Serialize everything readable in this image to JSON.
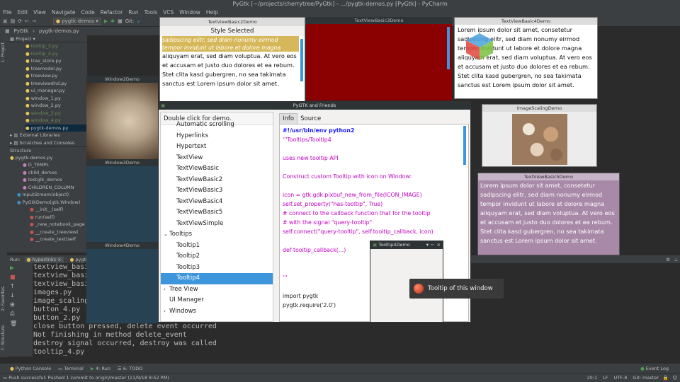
{
  "ide": {
    "title": "PyGtk [~/projects/cherrytree/PyGtk] - .../pygtk-demos.py [PyGtk] - PyCharm",
    "menu": [
      "File",
      "Edit",
      "View",
      "Navigate",
      "Code",
      "Refactor",
      "Run",
      "Tools",
      "VCS",
      "Window",
      "Help"
    ],
    "breadcrumb": [
      "PyGtk",
      "pygtk-demos.py"
    ],
    "run_config": "pygtk-demos",
    "git_label": "Git:",
    "project_header": "Project",
    "project_files": [
      {
        "name": "tooltip_3.py",
        "color": "green"
      },
      {
        "name": "tooltip_4.py",
        "color": "green"
      },
      {
        "name": "tree_store.py",
        "color": "normal"
      },
      {
        "name": "treemodel.py",
        "color": "normal"
      },
      {
        "name": "treeview.py",
        "color": "normal"
      },
      {
        "name": "treeviewdnd.py",
        "color": "normal"
      },
      {
        "name": "ui_manager.py",
        "color": "normal"
      },
      {
        "name": "window_1.py",
        "color": "normal"
      },
      {
        "name": "window_2.py",
        "color": "normal"
      },
      {
        "name": "window_3.py",
        "color": "green"
      },
      {
        "name": "window_4.py",
        "color": "green"
      },
      {
        "name": "pygtk-demos.py",
        "color": "selected"
      }
    ],
    "external": "External Libraries",
    "scratches": "Scratches and Consoles",
    "structure_title": "Structure",
    "structure_items": [
      "pygtk-demos.py",
      "D_TEMPL",
      "child_demos",
      "testgtk_demos",
      "CHILDREN_COLUMN",
      "InputStream(object)",
      "PyGtkDemo(gtk.Window)",
      "__init__(self)",
      "run(self)",
      "_new_notebook_page",
      "__create_treeview(",
      "__create_text(self"
    ],
    "run_label": "Run:",
    "run_tabs": [
      "hyperlinks",
      "pygtk-demos"
    ],
    "console": [
      "textview_basic",
      "textview_basic",
      "textview_basic",
      "images.py",
      "image_scaling",
      "button_4.py",
      "button_2.py",
      "close button pressed, delete event occurred",
      "Not finishing in method delete_event",
      "destroy signal occurred, destroy was called",
      "tooltip_4.py"
    ],
    "bottom_tabs": [
      "Python Console",
      "Terminal",
      "4: Run",
      "6: TODO"
    ],
    "event_log": "Event Log",
    "status_message": "Push successful: Pushed 1 commit to origin/master (11/9/18 8:52 PM)",
    "status_right": [
      "20:1",
      "LF",
      "UTF-8",
      "Git: master"
    ],
    "side_tabs": [
      "1: Project",
      "2: Favorites",
      "7: Structure"
    ]
  },
  "windows": {
    "style_selected": {
      "title": "TextViewBasic2Demo",
      "header": "Style Selected",
      "italic_text": "sadipscing elitr, sed diam nonumy eirmod tempor invidunt ut labore et dolore magna",
      "body": "aliquyam erat, sed diam voluptua. At vero eos et accusam et justo duo dolores et ea rebum. Stet clita kasd gubergren, no sea takimata sanctus est Lorem ipsum dolor sit amet."
    },
    "basic3": {
      "title": "TextViewBasic3Demo"
    },
    "basic4": {
      "title": "TextViewBasic4Demo",
      "body": "Lorem ipsum dolor sit amet, consetetur sadipscing elitr, sed diam nonumy eirmod tempor invidunt ut labore et dolore magna aliquyam erat, sed diam voluptua. At vero eos et accusam et justo duo dolores et ea rebum. Stet clita kasd gubergren, no sea takimata sanctus est Lorem ipsum dolor sit amet."
    },
    "window2": {
      "title": "Window2Demo"
    },
    "window3": {
      "title": "Window3Demo"
    },
    "window4": {
      "title": "Window4Demo"
    },
    "image_scaling": {
      "title": "ImageScalingDemo"
    },
    "basic5": {
      "title": "TextViewBasic5Demo",
      "body": "Lorem ipsum dolor sit amet, consetetur sadipscing elitr, sed diam nonumy eirmod tempor invidunt ut labore et dolore magna aliquyam erat, sed diam voluptua. At vero eos et accusam et justo duo dolores et ea rebum. Stet clita kasd gubergren, no sea takimata sanctus est Lorem ipsum dolor sit amet."
    },
    "friends": {
      "title": "PyGTK and Friends",
      "list_header": "Double click for demo.",
      "list_items": [
        {
          "label": "Automatic scrolling",
          "level": 1
        },
        {
          "label": "Hyperlinks",
          "level": 1
        },
        {
          "label": "Hypertext",
          "level": 1
        },
        {
          "label": "TextView",
          "level": 1
        },
        {
          "label": "TextViewBasic",
          "level": 1
        },
        {
          "label": "TextViewBasic2",
          "level": 1
        },
        {
          "label": "TextViewBasic3",
          "level": 1
        },
        {
          "label": "TextViewBasic4",
          "level": 1
        },
        {
          "label": "TextViewBasic5",
          "level": 1
        },
        {
          "label": "TextViewSimple",
          "level": 1
        },
        {
          "label": "Tooltips",
          "level": 0,
          "expanded": true
        },
        {
          "label": "Tooltip1",
          "level": 1
        },
        {
          "label": "Tooltip2",
          "level": 1
        },
        {
          "label": "Tooltip3",
          "level": 1
        },
        {
          "label": "Tooltip4",
          "level": 1,
          "selected": true
        },
        {
          "label": "Tree View",
          "level": 0,
          "expanded": false
        },
        {
          "label": "UI Manager",
          "level": 0
        },
        {
          "label": "Windows",
          "level": 0,
          "expanded": false
        }
      ],
      "tabs": [
        "Info",
        "Source"
      ],
      "code": [
        {
          "t": "#!/usr/bin/env python2",
          "c": "#1a1aff",
          "b": true
        },
        {
          "t": "'''Tooltips/Tooltip4",
          "c": "#c000c0"
        },
        {
          "t": "",
          "c": "#c000c0"
        },
        {
          "t": "uses new tooltip API",
          "c": "#c000c0"
        },
        {
          "t": "",
          "c": "#c000c0"
        },
        {
          "t": "Construct custom Tooltip with icon on Window:",
          "c": "#c000c0"
        },
        {
          "t": "",
          "c": "#c000c0"
        },
        {
          "t": "icon = gtk.gdk.pixbuf_new_from_file(ICON_IMAGE)",
          "c": "#c000c0"
        },
        {
          "t": "self.set_property(\"has-tooltip\", True)",
          "c": "#c000c0"
        },
        {
          "t": "# connect to the callback function that for the tooltip",
          "c": "#c000c0"
        },
        {
          "t": "# with the signal \"query-tooltip\"",
          "c": "#c000c0"
        },
        {
          "t": "self.connect(\"query-tooltip\", self.tooltip_callback, icon)",
          "c": "#c000c0"
        },
        {
          "t": "",
          "c": "#c000c0"
        },
        {
          "t": "def tooltip_callback(...)",
          "c": "#c000c0"
        },
        {
          "t": "",
          "c": "#c000c0"
        },
        {
          "t": "",
          "c": "#c000c0"
        },
        {
          "t": "'''",
          "c": "#c000c0"
        },
        {
          "t": "",
          "c": "#c000c0"
        },
        {
          "t": "import pygtk",
          "c": "#222222"
        },
        {
          "t": "pygtk.require('2.0')",
          "c": "#222222"
        }
      ]
    },
    "tooltip4": {
      "title": "Tooltip4Demo"
    },
    "tooltip_popup": {
      "text": "Tooltip of this window"
    }
  },
  "colors": {
    "selection": "#3d95dc",
    "maroon": "#8b0000",
    "lavender": "#a88aa8"
  }
}
